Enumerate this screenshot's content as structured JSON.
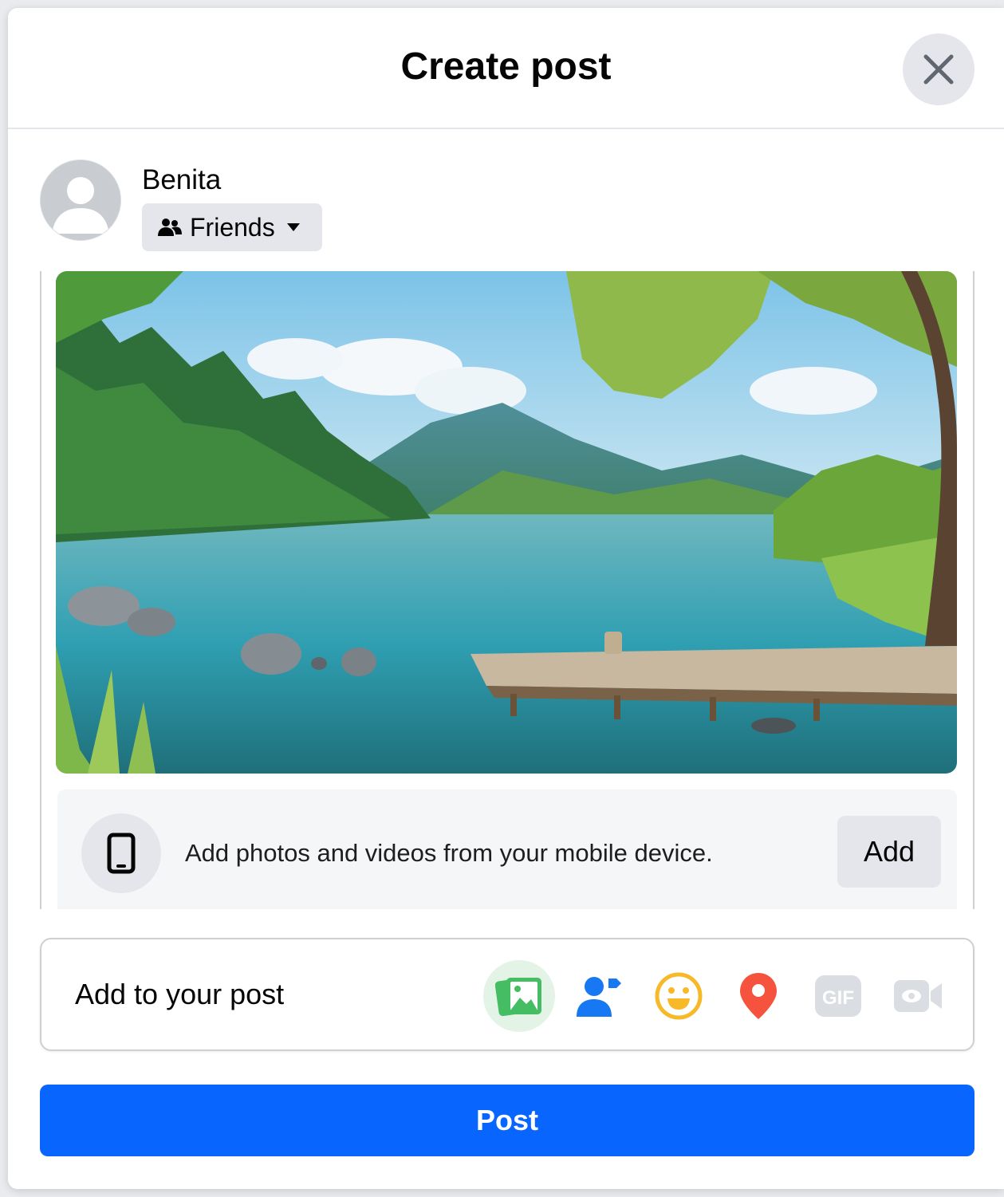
{
  "dialog": {
    "title": "Create post"
  },
  "user": {
    "name": "Benita",
    "audience": "Friends"
  },
  "media": {
    "mobile_prompt": "Add photos and videos from your mobile device.",
    "add_label": "Add"
  },
  "add_to_post": {
    "label": "Add to your post",
    "icons": [
      "photo-video-icon",
      "tag-people-icon",
      "feeling-icon",
      "check-in-icon",
      "gif-icon",
      "live-video-icon"
    ],
    "gif_text": "GIF"
  },
  "actions": {
    "post_label": "Post"
  },
  "colors": {
    "primary": "#0866ff",
    "photo_green": "#45bd62",
    "tag_blue": "#1877f2",
    "feeling_yellow": "#f7b928",
    "checkin_red": "#f5533d",
    "disabled_gray": "#bcc0c4"
  }
}
